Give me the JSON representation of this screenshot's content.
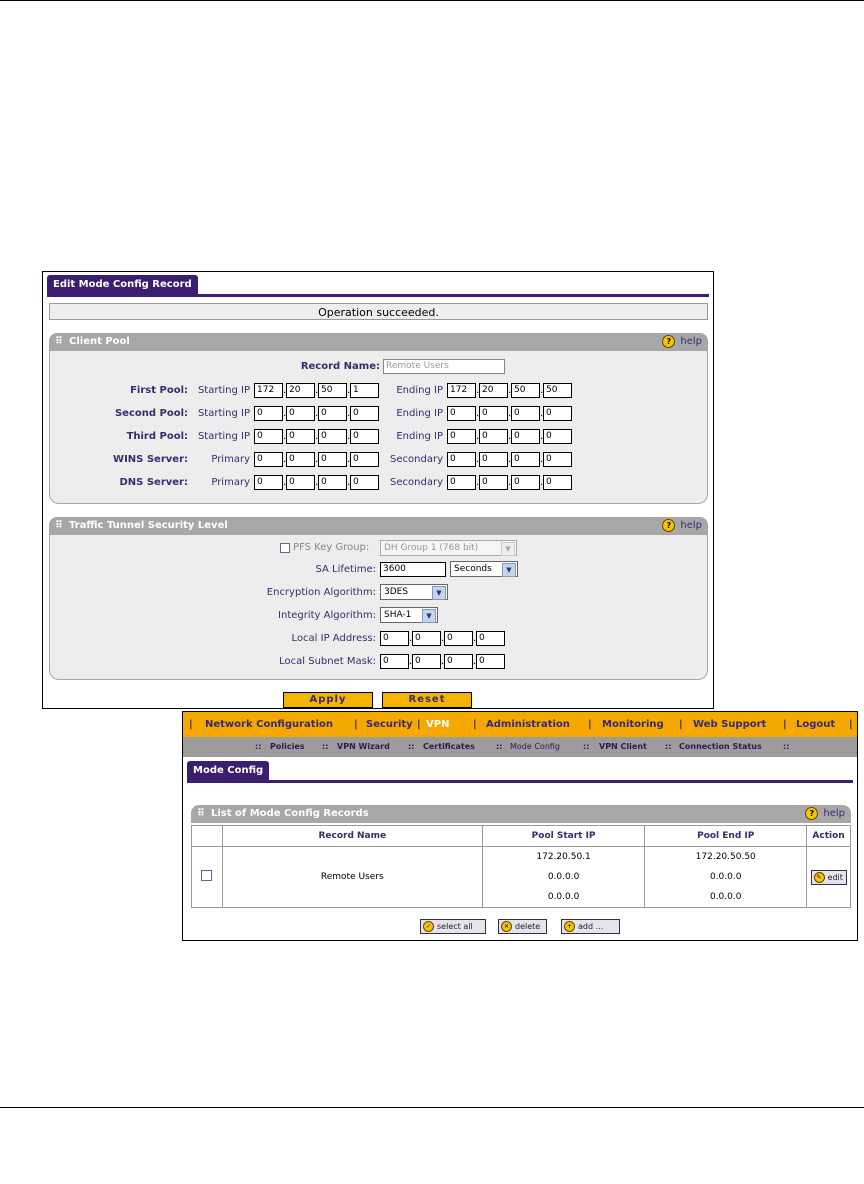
{
  "edit": {
    "tab": "Edit Mode Config Record",
    "message": "Operation succeeded.",
    "client_pool": {
      "title": "Client Pool",
      "help": "help",
      "record_name_label": "Record Name:",
      "record_name_value": "Remote Users",
      "rows": [
        {
          "label": "First Pool:",
          "left_sub": "Starting IP",
          "left": [
            "172",
            "20",
            "50",
            "1"
          ],
          "right_sub": "Ending IP",
          "right": [
            "172",
            "20",
            "50",
            "50"
          ]
        },
        {
          "label": "Second Pool:",
          "left_sub": "Starting IP",
          "left": [
            "0",
            "0",
            "0",
            "0"
          ],
          "right_sub": "Ending IP",
          "right": [
            "0",
            "0",
            "0",
            "0"
          ]
        },
        {
          "label": "Third Pool:",
          "left_sub": "Starting IP",
          "left": [
            "0",
            "0",
            "0",
            "0"
          ],
          "right_sub": "Ending IP",
          "right": [
            "0",
            "0",
            "0",
            "0"
          ]
        },
        {
          "label": "WINS Server:",
          "left_sub": "Primary",
          "left": [
            "0",
            "0",
            "0",
            "0"
          ],
          "right_sub": "Secondary",
          "right": [
            "0",
            "0",
            "0",
            "0"
          ]
        },
        {
          "label": "DNS Server:",
          "left_sub": "Primary",
          "left": [
            "0",
            "0",
            "0",
            "0"
          ],
          "right_sub": "Secondary",
          "right": [
            "0",
            "0",
            "0",
            "0"
          ]
        }
      ]
    },
    "traffic": {
      "title": "Traffic Tunnel Security Level",
      "help": "help",
      "pfs_label": "PFS Key Group:",
      "pfs_value": "DH Group 1 (768 bit)",
      "sa_label": "SA Lifetime:",
      "sa_value": "3600",
      "sa_unit": "Seconds",
      "enc_label": "Encryption Algorithm:",
      "enc_value": "3DES",
      "int_label": "Integrity Algorithm:",
      "int_value": "SHA-1",
      "local_ip_label": "Local IP Address:",
      "local_ip": [
        "0",
        "0",
        "0",
        "0"
      ],
      "local_mask_label": "Local Subnet Mask:",
      "local_mask": [
        "0",
        "0",
        "0",
        "0"
      ]
    },
    "apply": "Apply",
    "reset": "Reset"
  },
  "mode": {
    "nav": [
      "Network Configuration",
      "Security",
      "VPN",
      "Administration",
      "Monitoring",
      "Web Support",
      "Logout"
    ],
    "subnav": [
      "Policies",
      "VPN Wizard",
      "Certificates",
      "Mode Config",
      "VPN Client",
      "Connection Status"
    ],
    "tab": "Mode Config",
    "list_title": "List of Mode Config Records",
    "help": "help",
    "columns": [
      "Record Name",
      "Pool Start IP",
      "Pool End IP",
      "Action"
    ],
    "record": {
      "name": "Remote Users",
      "start": [
        "172.20.50.1",
        "0.0.0.0",
        "0.0.0.0"
      ],
      "end": [
        "172.20.50.50",
        "0.0.0.0",
        "0.0.0.0"
      ],
      "action": "edit"
    },
    "buttons": {
      "select_all": "select all",
      "delete": "delete",
      "add": "add ..."
    }
  }
}
